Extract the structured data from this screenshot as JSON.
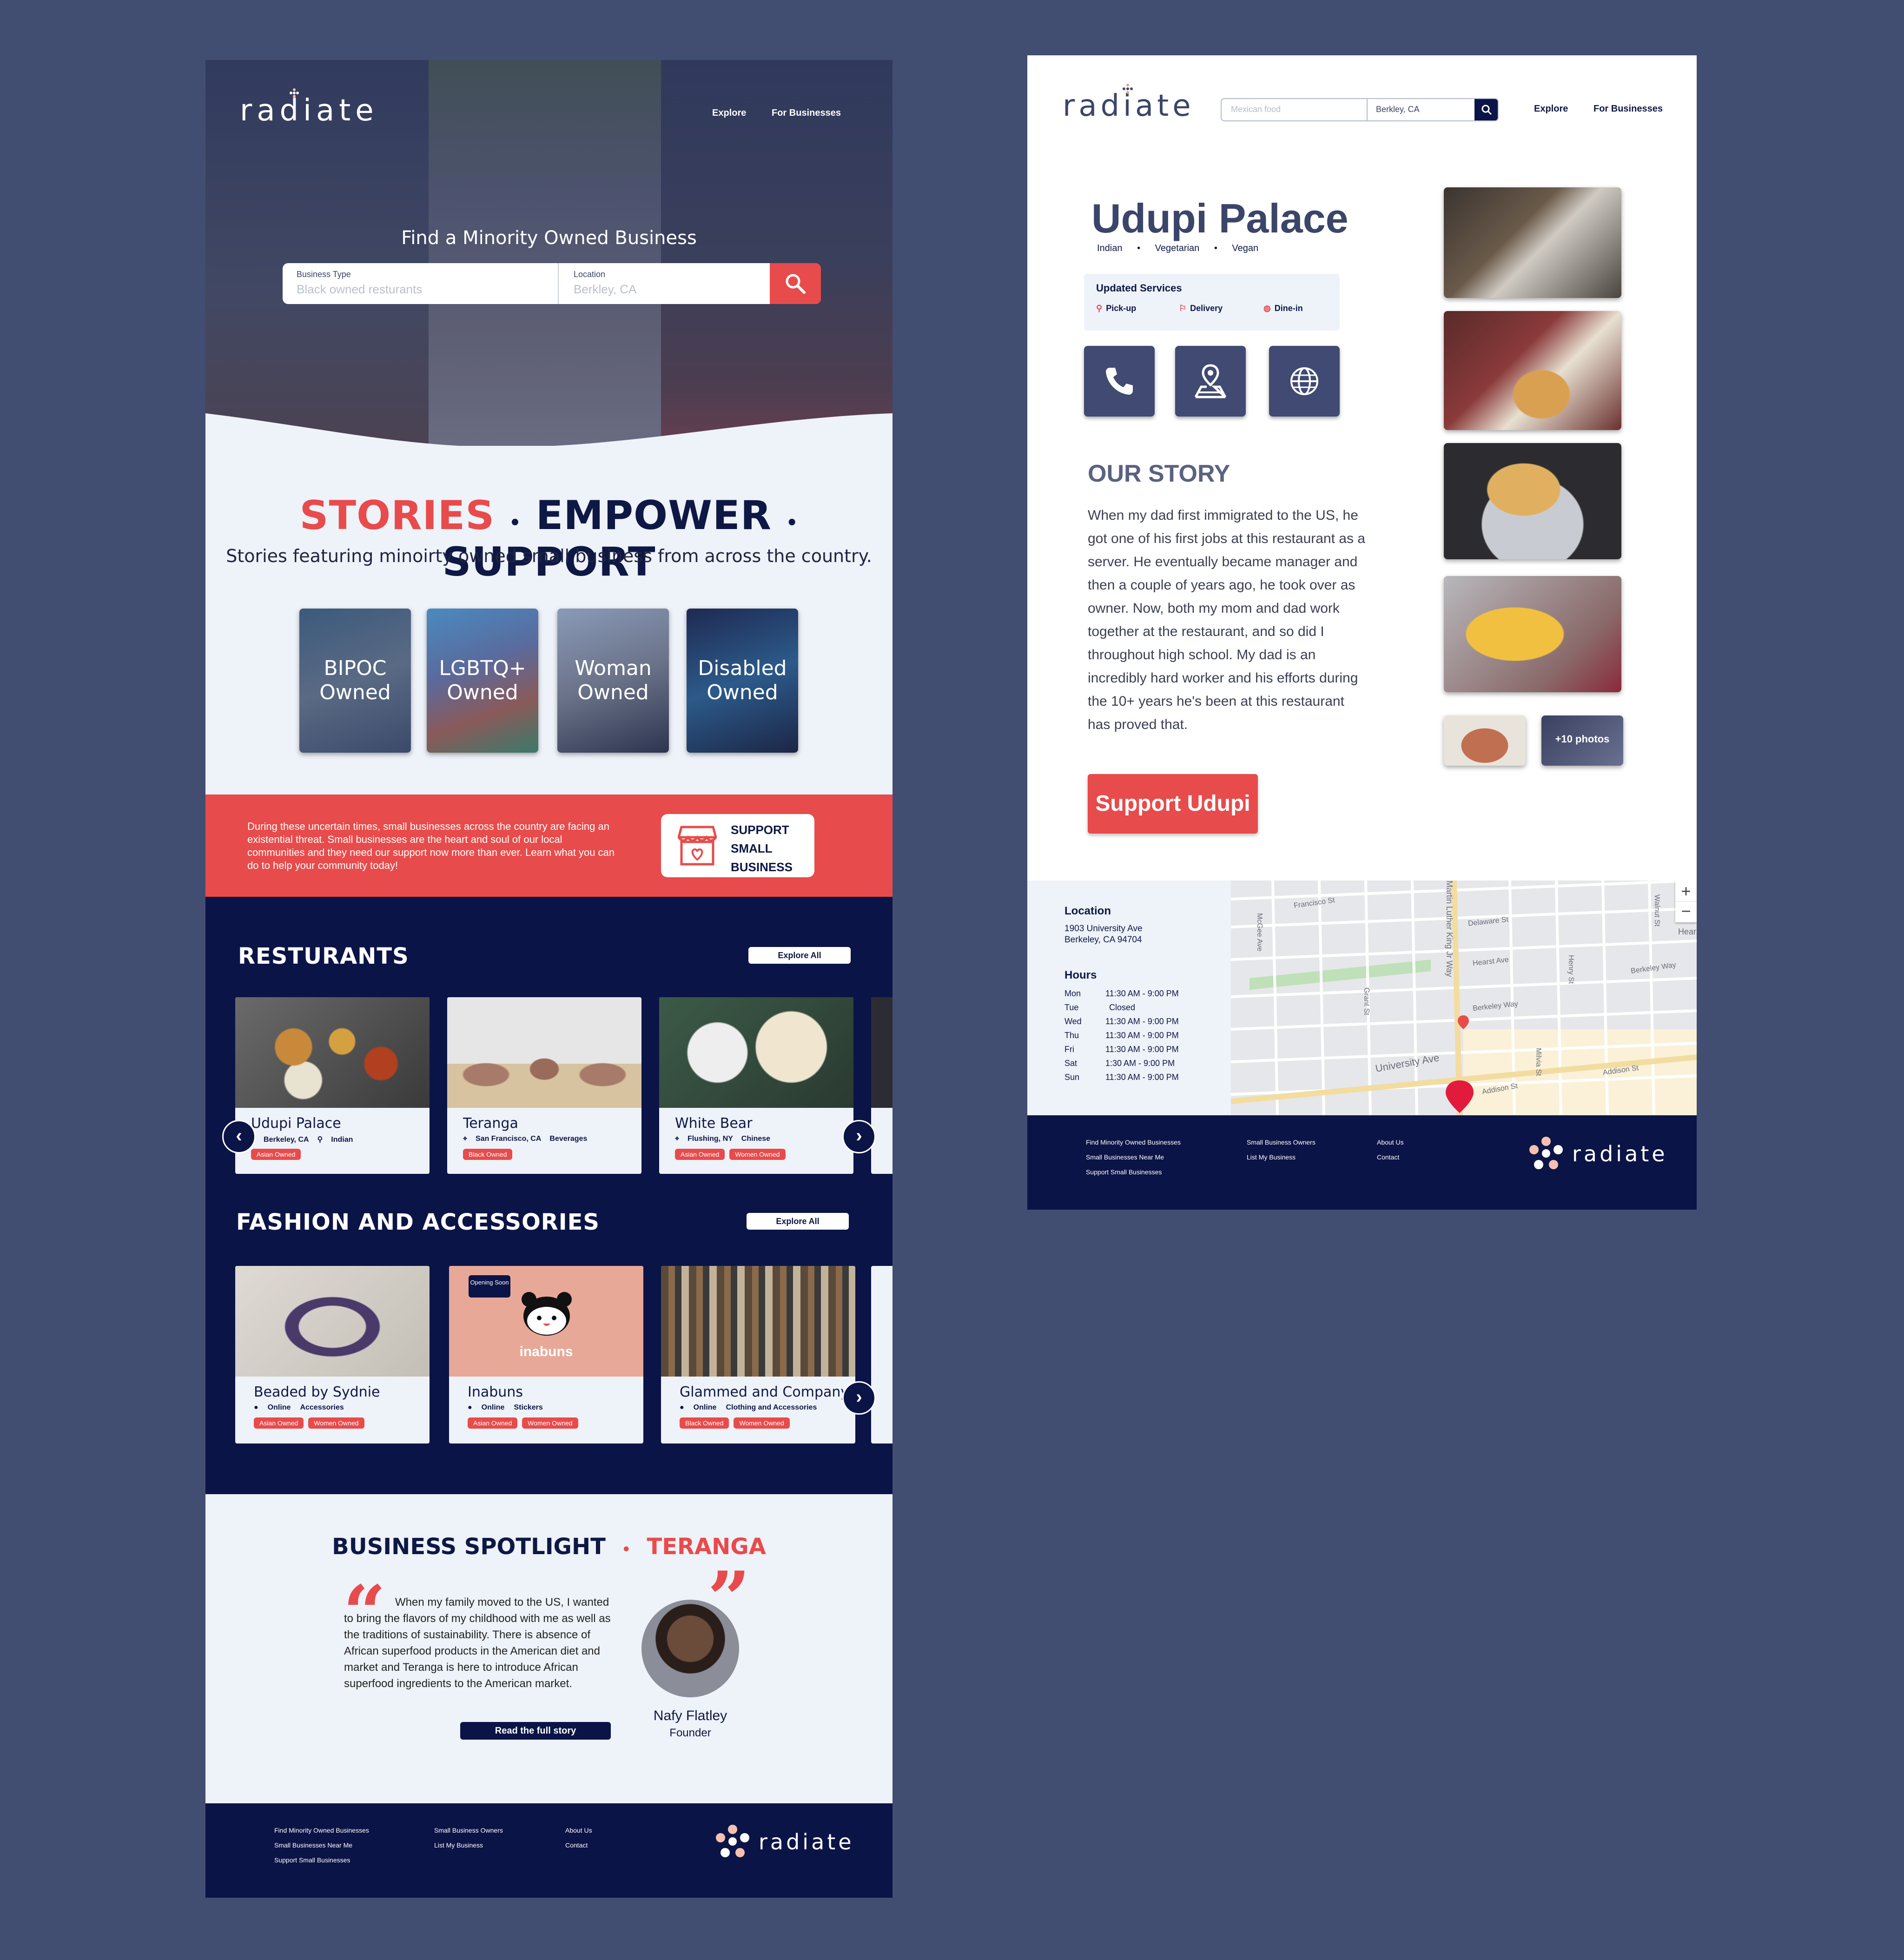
{
  "left_page": {
    "hero": {
      "logo": "radiate",
      "nav": {
        "explore": "Explore",
        "for_businesses": "For Businesses"
      },
      "title": "Find a Minority Owned Business",
      "search": {
        "type_label": "Business Type",
        "type_placeholder": "Black owned resturants",
        "location_label": "Location",
        "location_placeholder": "Berkley, CA"
      }
    },
    "tagline": {
      "word1": "STORIES",
      "sep": "•",
      "word2": "EMPOWER",
      "word3": "SUPPORT"
    },
    "tagline_sub": "Stories featuring minoirty owned small business from across the country.",
    "categories": [
      {
        "line1": "BIPOC",
        "line2": "Owned"
      },
      {
        "line1": "LGBTQ+",
        "line2": "Owned"
      },
      {
        "line1": "Woman",
        "line2": "Owned"
      },
      {
        "line1": "Disabled",
        "line2": "Owned"
      }
    ],
    "banner": {
      "text": "During these uncertain times, small businesses across the country are facing an existential threat. Small businesses are the heart and soul of our local communities and they need our support now more than ever. Learn what you can do to help your community today!",
      "button_line1": "SUPPORT",
      "button_line2": "SMALL",
      "button_line3": "BUSINESS"
    },
    "restaurants": {
      "title": "RESTURANTS",
      "explore": "Explore All",
      "cards": [
        {
          "name": "Udupi Palace",
          "location": "Berkeley, CA",
          "category": "Indian",
          "tags": [
            "Asian Owned"
          ]
        },
        {
          "name": "Teranga",
          "location": "San Francisco, CA",
          "category": "Beverages",
          "tags": [
            "Black Owned"
          ]
        },
        {
          "name": "White Bear",
          "location": "Flushing, NY",
          "category": "Chinese",
          "tags": [
            "Asian Owned",
            "Women Owned"
          ]
        }
      ]
    },
    "fashion": {
      "title": "FASHION AND ACCESSORIES",
      "explore": "Explore All",
      "opening_soon": "Opening Soon",
      "inabuns_logo": "inabuns",
      "cards": [
        {
          "name": "Beaded by Sydnie",
          "mode": "Online",
          "category": "Accessories",
          "tags": [
            "Asian Owned",
            "Women Owned"
          ]
        },
        {
          "name": "Inabuns",
          "mode": "Online",
          "category": "Stickers",
          "tags": [
            "Asian Owned",
            "Women Owned"
          ]
        },
        {
          "name": "Glammed and Company",
          "mode": "Online",
          "category": "Clothing and Accessories",
          "tags": [
            "Black Owned",
            "Women Owned"
          ]
        }
      ]
    },
    "spotlight": {
      "title": "BUSINESS SPOTLIGHT",
      "sep": "•",
      "business": "TERANGA",
      "quote": "When my family moved to the US, I wanted to bring the flavors of my childhood with me as well as the traditions of sustainability. There is absence of African superfood products in the American diet and market and Teranga is here to introduce African superfood ingredients to the American market.",
      "button": "Read the full story",
      "person": "Nafy Flatley",
      "role": "Founder"
    },
    "footer": {
      "col1": [
        "Find Minority Owned Businesses",
        "Small Businesses Near Me",
        "Support Small Businesses"
      ],
      "col2": [
        "Small Business Owners",
        "List My Business"
      ],
      "col3": [
        "About Us",
        "Contact"
      ],
      "logo": "radiate"
    }
  },
  "right_page": {
    "header": {
      "logo": "radiate",
      "search_placeholder": "Mexican food",
      "location_value": "Berkley, CA",
      "nav": {
        "explore": "Explore",
        "for_businesses": "For Businesses"
      }
    },
    "business": {
      "name": "Udupi Palace",
      "cuisine": [
        "Indian",
        "Vegetarian",
        "Vegan"
      ],
      "services_title": "Updated Services",
      "services": [
        "Pick-up",
        "Delivery",
        "Dine-in"
      ]
    },
    "story": {
      "title": "OUR STORY",
      "text": "When my dad first immigrated to the US, he got one of his first jobs at this restaurant as a server. He eventually became manager and then a couple of years ago, he took over as owner. Now, both my mom and dad work together at the restaurant, and so did I throughout high school. My dad is an incredibly hard worker and his efforts during the 10+ years he's been at this restaurant has proved that."
    },
    "support_button": "Support Udupi",
    "more_photos": "+10 photos",
    "location": {
      "title": "Location",
      "line1": "1903 University Ave",
      "line2": "Berkeley, CA 94704",
      "hours_title": "Hours",
      "hours": [
        {
          "day": "Mon",
          "time": "11:30 AM - 9:00 PM"
        },
        {
          "day": "Tue",
          "time": "Closed"
        },
        {
          "day": "Wed",
          "time": "11:30 AM - 9:00 PM"
        },
        {
          "day": "Thu",
          "time": "11:30 AM - 9:00 PM"
        },
        {
          "day": "Fri",
          "time": "11:30 AM - 9:00 PM"
        },
        {
          "day": "Sat",
          "time": "1:30 AM - 9:00 PM"
        },
        {
          "day": "Sun",
          "time": "11:30 AM - 9:00 PM"
        }
      ]
    },
    "map": {
      "zoom_in": "+",
      "zoom_out": "−",
      "streets": [
        "Francisco St",
        "Delaware St",
        "Hearst Ave",
        "Hearst",
        "Berkeley Way",
        "University Ave",
        "Addison St",
        "McGee Ave",
        "Grant St",
        "Walnut St",
        "Henry St",
        "Milvia St",
        "Martin Luther King Jr Way"
      ]
    },
    "footer": {
      "col1": [
        "Find Minority Owned Businesses",
        "Small Businesses Near Me",
        "Support Small Businesses"
      ],
      "col2": [
        "Small Business Owners",
        "List My Business"
      ],
      "col3": [
        "About Us",
        "Contact"
      ],
      "logo": "radiate"
    }
  },
  "colors": {
    "background": "#424d72",
    "navy": "#0b1446",
    "accent_red": "#e84b4b",
    "light": "#eef2f9",
    "slate": "#404a72"
  }
}
